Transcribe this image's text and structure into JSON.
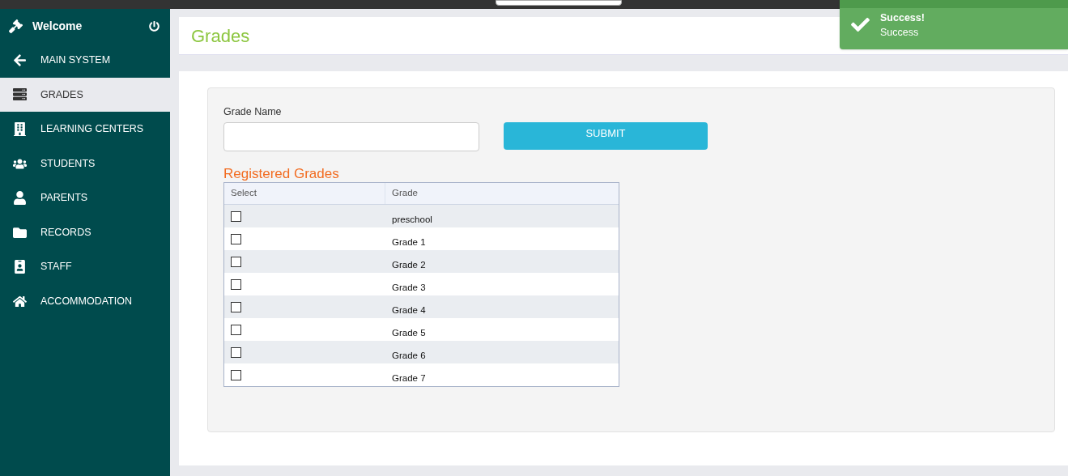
{
  "sidebar": {
    "title": "Welcome",
    "items": [
      {
        "label": "MAIN SYSTEM",
        "selected": false
      },
      {
        "label": "GRADES",
        "selected": true
      },
      {
        "label": "LEARNING CENTERS",
        "selected": false
      },
      {
        "label": "STUDENTS",
        "selected": false
      },
      {
        "label": "PARENTS",
        "selected": false
      },
      {
        "label": "RECORDS",
        "selected": false
      },
      {
        "label": "STAFF",
        "selected": false
      },
      {
        "label": "ACCOMMODATION",
        "selected": false
      }
    ]
  },
  "page_title": "Grades",
  "form": {
    "label": "Grade Name",
    "submit": "SUBMIT"
  },
  "table": {
    "title": "Registered Grades",
    "columns": [
      "Select",
      "Grade"
    ],
    "rows": [
      {
        "grade": "preschool",
        "checked": false
      },
      {
        "grade": "Grade 1",
        "checked": false
      },
      {
        "grade": "Grade 2",
        "checked": false
      },
      {
        "grade": "Grade 3",
        "checked": false
      },
      {
        "grade": "Grade 4",
        "checked": false
      },
      {
        "grade": "Grade 5",
        "checked": false
      },
      {
        "grade": "Grade 6",
        "checked": false
      },
      {
        "grade": "Grade 7",
        "checked": false
      }
    ]
  },
  "toast": {
    "title": "Success!",
    "message": "Success"
  }
}
